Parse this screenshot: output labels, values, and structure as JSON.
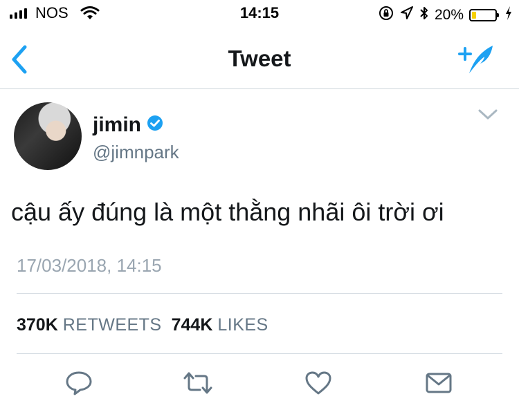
{
  "status_bar": {
    "carrier": "NOS",
    "time": "14:15",
    "battery_percent": "20%",
    "battery_level": 0.2,
    "icons": [
      "signal-icon",
      "wifi-icon",
      "rotation-lock-icon",
      "location-icon",
      "bluetooth-icon",
      "battery-icon",
      "charging-icon"
    ]
  },
  "nav": {
    "title": "Tweet",
    "back_icon": "chevron-left-icon",
    "compose_icon": "compose-tweet-icon"
  },
  "tweet": {
    "display_name": "jimin",
    "handle": "@jimnpark",
    "verified": true,
    "text": "cậu ấy đúng là một thằng nhãi ôi trời ơi",
    "timestamp": "17/03/2018, 14:15",
    "retweets_count": "370K",
    "retweets_label": "RETWEETS",
    "likes_count": "744K",
    "likes_label": "LIKES"
  },
  "actions": [
    "reply-icon",
    "retweet-icon",
    "like-icon",
    "direct-message-icon"
  ],
  "colors": {
    "accent": "#1da1f2",
    "text": "#14171a",
    "muted": "#657786",
    "timestamp": "#9aa6b1",
    "action_icon": "#657786",
    "battery_fill": "#f7d000"
  }
}
